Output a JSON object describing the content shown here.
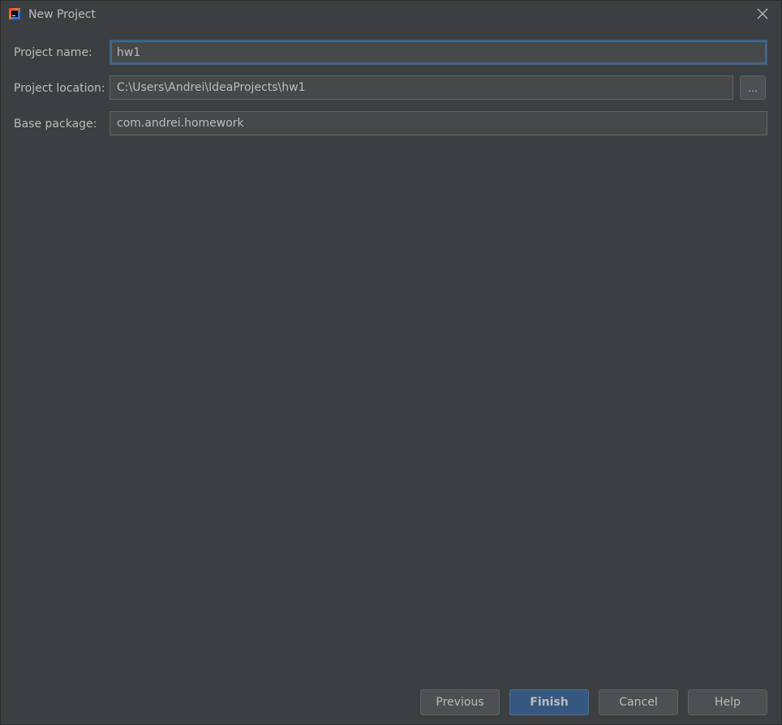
{
  "window": {
    "title": "New Project"
  },
  "form": {
    "project_name": {
      "label": "Project name:",
      "value": "hw1"
    },
    "project_location": {
      "label": "Project location:",
      "value": "C:\\Users\\Andrei\\IdeaProjects\\hw1",
      "browse_label": "..."
    },
    "base_package": {
      "label": "Base package:",
      "value": "com.andrei.homework"
    }
  },
  "footer": {
    "previous_label": "Previous",
    "finish_label": "Finish",
    "cancel_label": "Cancel",
    "help_label": "Help"
  },
  "colors": {
    "background": "#3c3f41",
    "field_background": "#45494a",
    "focus_border": "#3d6185",
    "primary_button": "#365880",
    "text": "#bbbbbb"
  },
  "icons": {
    "app": "intellij-idea-icon",
    "close": "close-icon"
  }
}
